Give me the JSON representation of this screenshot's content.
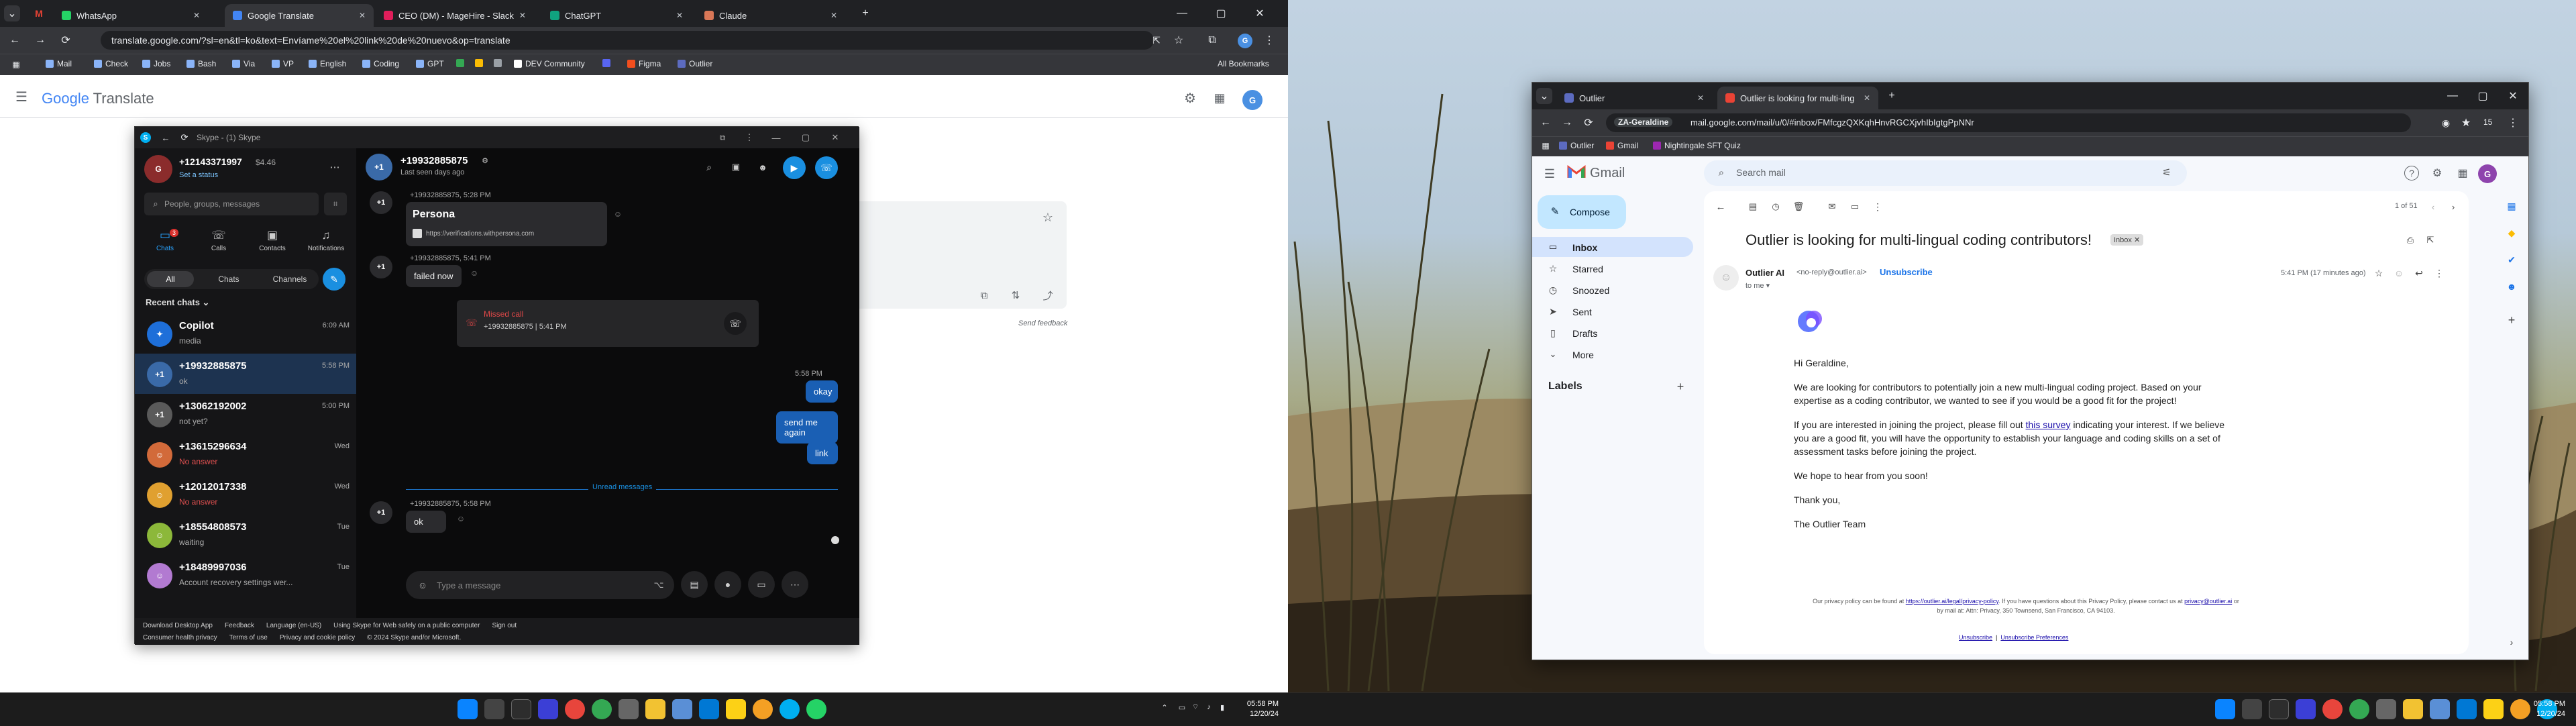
{
  "left_browser": {
    "tabs": [
      {
        "label": "WhatsApp",
        "color": "#25d366"
      },
      {
        "label": "Google Translate",
        "color": "#4285f4"
      },
      {
        "label": "CEO (DM) - MageHire - Slack",
        "color": "#e01e5a"
      },
      {
        "label": "ChatGPT",
        "color": "#10a37f"
      },
      {
        "label": "Claude",
        "color": "#d97757"
      }
    ],
    "url": "translate.google.com/?sl=en&tl=ko&text=Envíame%20el%20link%20de%20nuevo&op=translate",
    "bookmarks": [
      "Mail",
      "Check",
      "Jobs",
      "Bash",
      "Via",
      "VP",
      "English",
      "Coding",
      "GPT",
      "",
      "",
      "",
      "DEV Community",
      "",
      "Figma",
      "Outlier"
    ],
    "all_bookmarks": "All Bookmarks",
    "translate_logo": {
      "google": "Google",
      "product": "Translate"
    },
    "send_feedback": "Send feedback"
  },
  "skype": {
    "window_title": "Skype - (1) Skype",
    "profile": {
      "name": "+12143371997",
      "balance": "$4.46",
      "status_link": "Set a status"
    },
    "search_placeholder": "People, groups, messages",
    "nav": [
      {
        "label": "Chats",
        "badge": "3"
      },
      {
        "label": "Calls",
        "badge": ""
      },
      {
        "label": "Contacts",
        "badge": ""
      },
      {
        "label": "Notifications",
        "badge": ""
      }
    ],
    "filters": [
      "All",
      "Chats",
      "Channels"
    ],
    "recent_label": "Recent chats",
    "chats": [
      {
        "name": "Copilot",
        "preview": "media",
        "time": "6:09 AM",
        "avatar_color": "#1e6fd9",
        "selected": false
      },
      {
        "name": "+19932885875",
        "preview": "ok",
        "time": "5:58 PM",
        "avatar_color": "#3a6aa8",
        "selected": true
      },
      {
        "name": "+13062192002",
        "preview": "not yet?",
        "time": "5:00 PM",
        "avatar_color": "#5a5a5a",
        "selected": false
      },
      {
        "name": "+13615296634",
        "preview": "No answer",
        "time": "Wed",
        "avatar_color": "#d26a3a",
        "selected": false
      },
      {
        "name": "+12012017338",
        "preview": "No answer",
        "time": "Wed",
        "avatar_color": "#e0a030",
        "selected": false
      },
      {
        "name": "+18554808573",
        "preview": "waiting",
        "time": "Tue",
        "avatar_color": "#8cb83a",
        "selected": false
      },
      {
        "name": "+18489997036",
        "preview": "Account recovery settings wer...",
        "time": "Tue",
        "avatar_color": "#b27ad1",
        "selected": false
      }
    ],
    "chat_header": {
      "name": "+19932885875",
      "subtitle": "Last seen days ago",
      "avatar": "+1"
    },
    "messages": [
      {
        "meta": "+19932885875, 5:28 PM",
        "title": "Persona",
        "link": "https://verifications.withpersona.com"
      },
      {
        "meta": "+19932885875, 5:41 PM",
        "text": "failed now"
      }
    ],
    "missed_call": {
      "title": "Missed call",
      "detail": "+19932885875 | 5:41 PM"
    },
    "out_time": "5:58 PM",
    "outgoing": [
      "okay",
      "send me again",
      "link"
    ],
    "unread_label": "Unread messages",
    "last_message": {
      "meta": "+19932885875, 5:58 PM",
      "text": "ok"
    },
    "compose_placeholder": "Type a message",
    "footer_row1": [
      "Download Desktop App",
      "Feedback",
      "Language (en-US)",
      "Using Skype for Web safely on a public computer",
      "Sign out"
    ],
    "footer_row2": [
      "Consumer health privacy",
      "Terms of use",
      "Privacy and cookie policy",
      "© 2024 Skype and/or Microsoft."
    ]
  },
  "gmail": {
    "tabs": [
      "Outlier",
      "Outlier is looking for multi-ling"
    ],
    "profile_chip": "ZA-Geraldine",
    "url": "mail.google.com/mail/u/0/#inbox/FMfcgzQXKqhHnvRGCXjvhIbIgtgPpNNr",
    "bookmarks": [
      "Outlier",
      "Gmail",
      "Nightingale SFT Quiz"
    ],
    "logo_text": "Gmail",
    "search_placeholder": "Search mail",
    "compose": "Compose",
    "nav": [
      {
        "label": "Inbox",
        "active": true
      },
      {
        "label": "Starred",
        "active": false
      },
      {
        "label": "Snoozed",
        "active": false
      },
      {
        "label": "Sent",
        "active": false
      },
      {
        "label": "Drafts",
        "active": false
      },
      {
        "label": "More",
        "active": false
      }
    ],
    "labels_title": "Labels",
    "pagination": "1 of 51",
    "subject": "Outlier is looking for multi-lingual coding contributors!",
    "inbox_badge": "Inbox",
    "sender": {
      "name": "Outlier AI",
      "email": "<no-reply@outlier.ai>",
      "unsubscribe": "Unsubscribe",
      "to": "to me"
    },
    "received": "5:41 PM (17 minutes ago)",
    "avatar_letter": "G",
    "body": {
      "greeting": "Hi Geraldine,",
      "p1": "We are looking for contributors to potentially join a new multi-lingual coding project. Based on your expertise as a coding contributor, we wanted to see if you would be a good fit for the project!",
      "p2a": "If you are interested in joining the project, please fill out ",
      "p2link": "this survey",
      "p2b": " indicating your interest. If we believe you are a good fit, you will have the opportunity to establish your language and coding skills on a set of assessment tasks before joining the project.",
      "p3": "We hope to hear from you soon!",
      "p4": "Thank you,",
      "p5": "The Outlier Team",
      "privacy_a": "Our privacy policy can be found at ",
      "privacy_link": "https://outlier.ai/legal/privacy-policy",
      "privacy_b": ". If you have questions about this Privacy Policy, please contact us at ",
      "privacy_email": "privacy@outlier.ai",
      "privacy_c": " or by mail at: Attn: Privacy, 350 Townsend, San Francisco, CA 94103.",
      "unsub": "Unsubscribe",
      "unsub_pref": "Unsubscribe Preferences"
    }
  },
  "taskbar": {
    "time": "05:58 PM",
    "date": "12/20/24"
  }
}
